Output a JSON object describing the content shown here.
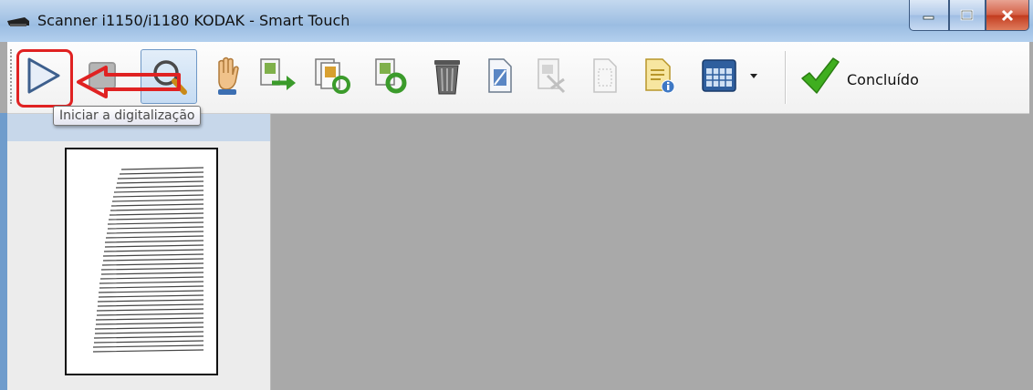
{
  "window": {
    "title": "Scanner i1150/i1180 KODAK - Smart Touch",
    "controls": [
      "minimize-icon",
      "maximize-icon",
      "close-icon"
    ]
  },
  "toolbar": {
    "buttons": [
      {
        "icon": "start-scan-play-icon"
      },
      {
        "icon": "stop-icon"
      },
      {
        "icon": "zoom-magnifier-icon"
      },
      {
        "icon": "pan-hand-icon"
      },
      {
        "icon": "rotate-page-icon"
      },
      {
        "icon": "rotate-page-alt-icon"
      },
      {
        "icon": "rotate-all-icon"
      },
      {
        "icon": "delete-trash-icon"
      },
      {
        "icon": "page-image-icon"
      },
      {
        "icon": "crop-page-icon"
      },
      {
        "icon": "blank-page-icon"
      },
      {
        "icon": "document-info-icon"
      },
      {
        "icon": "thumbnail-grid-icon"
      },
      {
        "icon": "dropdown-arrow-icon"
      }
    ],
    "done_label": "Concluído"
  },
  "tooltip": {
    "text": "Iniciar a digitalização"
  },
  "colors": {
    "highlight": "#e02222",
    "annotation_arrow": "#e02222",
    "done_check": "#3fae1f",
    "workspace": "#a9a9a9"
  }
}
